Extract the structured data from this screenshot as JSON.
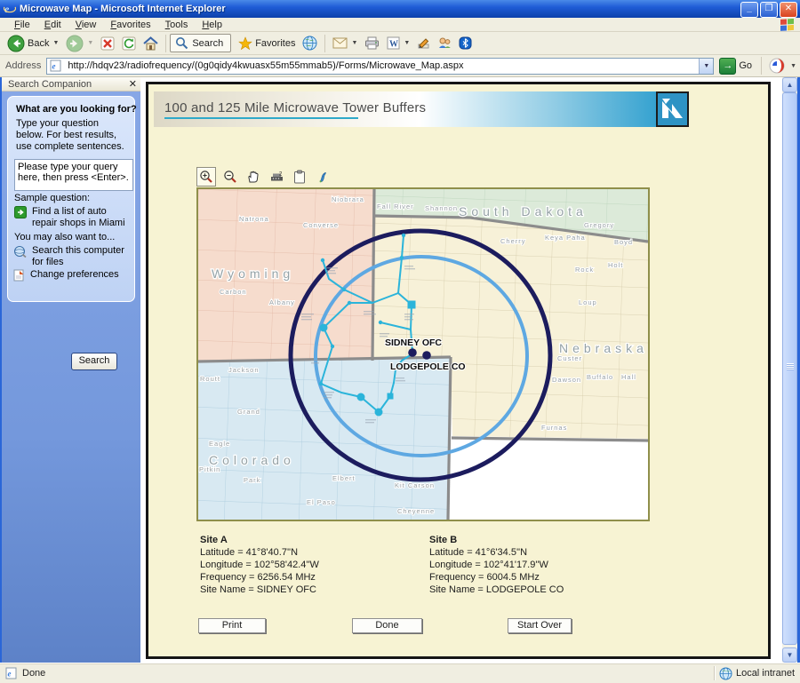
{
  "window": {
    "title": "Microwave Map - Microsoft Internet Explorer"
  },
  "menu_bar": {
    "items": [
      {
        "label": "File"
      },
      {
        "label": "Edit"
      },
      {
        "label": "View"
      },
      {
        "label": "Favorites"
      },
      {
        "label": "Tools"
      },
      {
        "label": "Help"
      }
    ]
  },
  "toolbar": {
    "back": "Back",
    "search": "Search",
    "favorites": "Favorites"
  },
  "address_bar": {
    "label": "Address",
    "url": "http://hdqv23/radiofrequency/(0g0qidy4kwuasx55m55mmab5)/Forms/Microwave_Map.aspx",
    "go": "Go"
  },
  "sidebar": {
    "title": "Search Companion",
    "heading": "What are you looking for?",
    "instructions": "Type your question below. For best results, use complete sentences.",
    "query_text": "Please type your query here, then press <Enter>.",
    "sample_label": "Sample question:",
    "sample_link": "Find a list of auto repair shops in Miami",
    "also_label": "You may also want to...",
    "search_files": "Search this computer for files",
    "change_prefs": "Change preferences",
    "search_button": "Search"
  },
  "page": {
    "title": "100 and 125 Mile Microwave Tower Buffers",
    "map": {
      "states": [
        {
          "text": "Wyoming"
        },
        {
          "text": "South Dakota"
        },
        {
          "text": "Nebraska"
        },
        {
          "text": "Colorado"
        }
      ],
      "counties": [
        {
          "text": "Natrona"
        },
        {
          "text": "Converse"
        },
        {
          "text": "Niobrara"
        },
        {
          "text": "Fall River"
        },
        {
          "text": "Shannon"
        },
        {
          "text": "Gregory"
        },
        {
          "text": "Cherry"
        },
        {
          "text": "Keya Paha"
        },
        {
          "text": "Boyd"
        },
        {
          "text": "Rock"
        },
        {
          "text": "Holt"
        },
        {
          "text": "Loup"
        },
        {
          "text": "Custer"
        },
        {
          "text": "Dawson"
        },
        {
          "text": "Buffalo"
        },
        {
          "text": "Hall"
        },
        {
          "text": "Furnas"
        },
        {
          "text": "Carbon"
        },
        {
          "text": "Albany"
        },
        {
          "text": "Jackson"
        },
        {
          "text": "Routt"
        },
        {
          "text": "Grand"
        },
        {
          "text": "Eagle"
        },
        {
          "text": "Pitkin"
        },
        {
          "text": "Park"
        },
        {
          "text": "Elbert"
        },
        {
          "text": "El Paso"
        },
        {
          "text": "Kit Carson"
        },
        {
          "text": "Cheyenne"
        }
      ],
      "sites": {
        "a": "SIDNEY OFC",
        "b": "LODGEPOLE CO"
      },
      "colors": {
        "buffer_125": "#1c1c5e",
        "buffer_100": "#5ea8e2",
        "network": "#2bb4da",
        "wyoming": "#f6dccd",
        "south_dakota": "#dcead9",
        "nebraska": "#f7f1d8",
        "colorado": "#d8e9f2",
        "state_border": "#8c8c8c"
      }
    },
    "site_a": {
      "title": "Site A",
      "lines": [
        "Latitude = 41°8'40.7''N",
        "Longitude = 102°58'42.4''W",
        "Frequency = 6256.54 MHz",
        "Site Name = SIDNEY OFC"
      ]
    },
    "site_b": {
      "title": "Site B",
      "lines": [
        "Latitude = 41°6'34.5''N",
        "Longitude = 102°41'17.9''W",
        "Frequency = 6004.5 MHz",
        "Site Name = LODGEPOLE CO"
      ]
    },
    "buttons": {
      "print": "Print",
      "done": "Done",
      "start_over": "Start Over"
    }
  },
  "status_bar": {
    "status": "Done",
    "zone": "Local intranet"
  }
}
